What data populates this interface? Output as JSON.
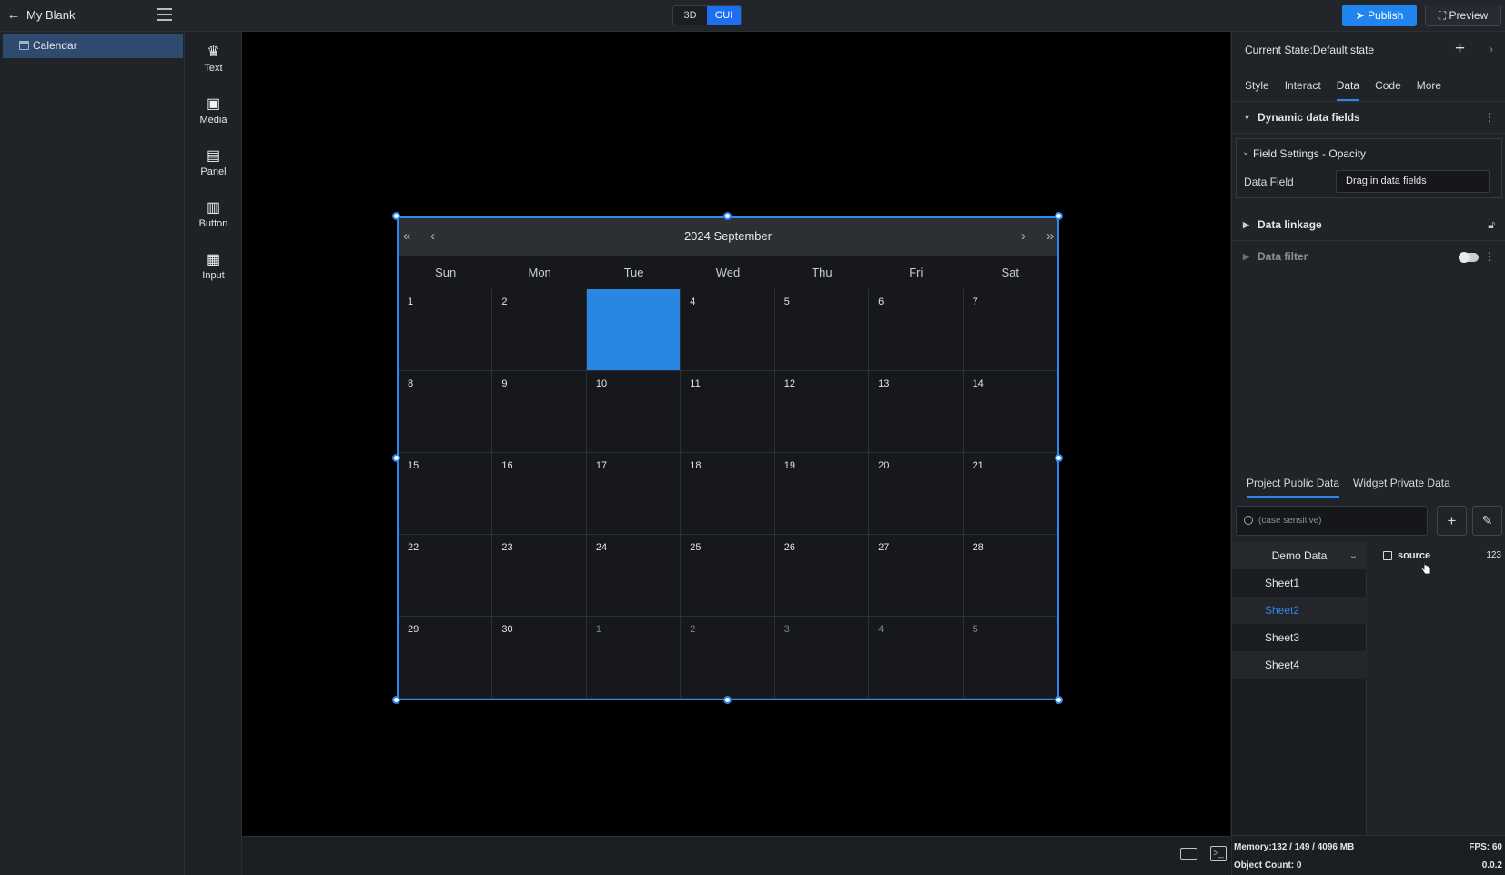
{
  "topbar": {
    "project_name": "My Blank",
    "mode_3d": "3D",
    "mode_gui": "GUI",
    "publish_label": "Publish",
    "preview_label": "Preview"
  },
  "layers": {
    "items": [
      {
        "label": "Calendar"
      }
    ]
  },
  "tools": [
    {
      "label": "Text",
      "icon": "crown-icon"
    },
    {
      "label": "Media",
      "icon": "media-icon"
    },
    {
      "label": "Panel",
      "icon": "panel-icon"
    },
    {
      "label": "Button",
      "icon": "bar-chart-icon"
    },
    {
      "label": "Input",
      "icon": "input-icon"
    }
  ],
  "calendar": {
    "title": "2024 September",
    "weekdays": [
      "Sun",
      "Mon",
      "Tue",
      "Wed",
      "Thu",
      "Fri",
      "Sat"
    ],
    "days": [
      "1",
      "2",
      "",
      "4",
      "5",
      "6",
      "7",
      "8",
      "9",
      "10",
      "11",
      "12",
      "13",
      "14",
      "15",
      "16",
      "17",
      "18",
      "19",
      "20",
      "21",
      "22",
      "23",
      "24",
      "25",
      "26",
      "27",
      "28",
      "29",
      "30",
      "1",
      "2",
      "3",
      "4",
      "5"
    ],
    "highlighted_index": 2,
    "other_month_from_index": 30,
    "highlight_color": "#2787e2"
  },
  "rpanel": {
    "current_state": "Current State:Default state",
    "tabs": [
      "Style",
      "Interact",
      "Data",
      "Code",
      "More"
    ],
    "active_tab": "Data",
    "sections": {
      "dynamic_fields": "Dynamic data fields",
      "field_settings": "Field Settings - Opacity",
      "data_field_label": "Data Field",
      "data_field_placeholder": "Drag in data fields",
      "data_linkage": "Data linkage",
      "data_filter": "Data filter"
    }
  },
  "datapanel": {
    "tabs": [
      "Project Public Data",
      "Widget Private Data"
    ],
    "search_placeholder": "(case sensitive)",
    "source_name": "Demo Data",
    "sheets": [
      "Sheet1",
      "Sheet2",
      "Sheet3",
      "Sheet4"
    ],
    "selected_sheet": "Sheet2",
    "field_name": "source",
    "field_type": "123"
  },
  "footer": {
    "memory": "Memory:132 / 149 / 4096 MB",
    "fps": "FPS: 60",
    "object_count": "Object Count: 0",
    "version": "0.0.2"
  },
  "colors": {
    "accent": "#2f86ef",
    "publish": "#2185f0"
  }
}
